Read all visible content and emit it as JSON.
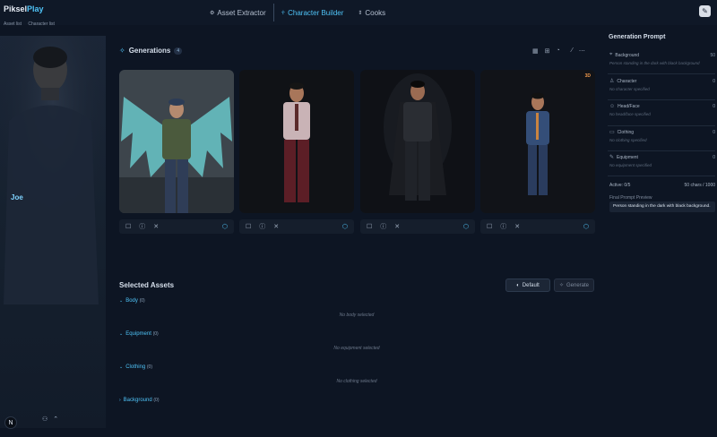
{
  "app": {
    "logo_main": "Piksel",
    "logo_accent": "Play"
  },
  "breadcrumbs": [
    "Asset list",
    "Character list"
  ],
  "nav": {
    "tabs": [
      {
        "label": "Asset Extractor",
        "icon": "extract-icon"
      },
      {
        "label": "Character Builder",
        "icon": "person-icon",
        "active": true
      },
      {
        "label": "Cooks",
        "icon": "cook-icon"
      }
    ],
    "tool_icon": "wrench-icon"
  },
  "character": {
    "name": "Joe"
  },
  "generations": {
    "title": "Generations",
    "count": "4",
    "cards": [
      {
        "badge": ""
      },
      {
        "badge": ""
      },
      {
        "badge": ""
      },
      {
        "badge": "3D"
      }
    ]
  },
  "selected_assets": {
    "title": "Selected Assets",
    "default_label": "Default",
    "generate_label": "Generate",
    "sections": [
      {
        "label": "Body",
        "count": "(0)",
        "empty": "No body selected"
      },
      {
        "label": "Equipment",
        "count": "(0)",
        "empty": "No equipment selected"
      },
      {
        "label": "Clothing",
        "count": "(0)",
        "empty": "No clothing selected"
      },
      {
        "label": "Background",
        "count": "(0)",
        "empty": ""
      }
    ]
  },
  "prompt": {
    "title": "Generation Prompt",
    "items": [
      {
        "label": "Background",
        "count": "50",
        "sub": "Person standing in the dark with black background"
      },
      {
        "label": "Character",
        "count": "0",
        "sub": "No character specified"
      },
      {
        "label": "Head/Face",
        "count": "0",
        "sub": "No head/face specified"
      },
      {
        "label": "Clothing",
        "count": "0",
        "sub": "No clothing specified"
      },
      {
        "label": "Equipment",
        "count": "0",
        "sub": "No equipment specified"
      }
    ],
    "active": "Active: 0/5",
    "chars": "50 chars / 1000",
    "preview_label": "Final Prompt Preview",
    "preview_text": "Person standing in the dark with black background."
  },
  "colors": {
    "accent": "#4fc3f7",
    "bg": "#0d1523",
    "badge3d": "#f2994a"
  }
}
